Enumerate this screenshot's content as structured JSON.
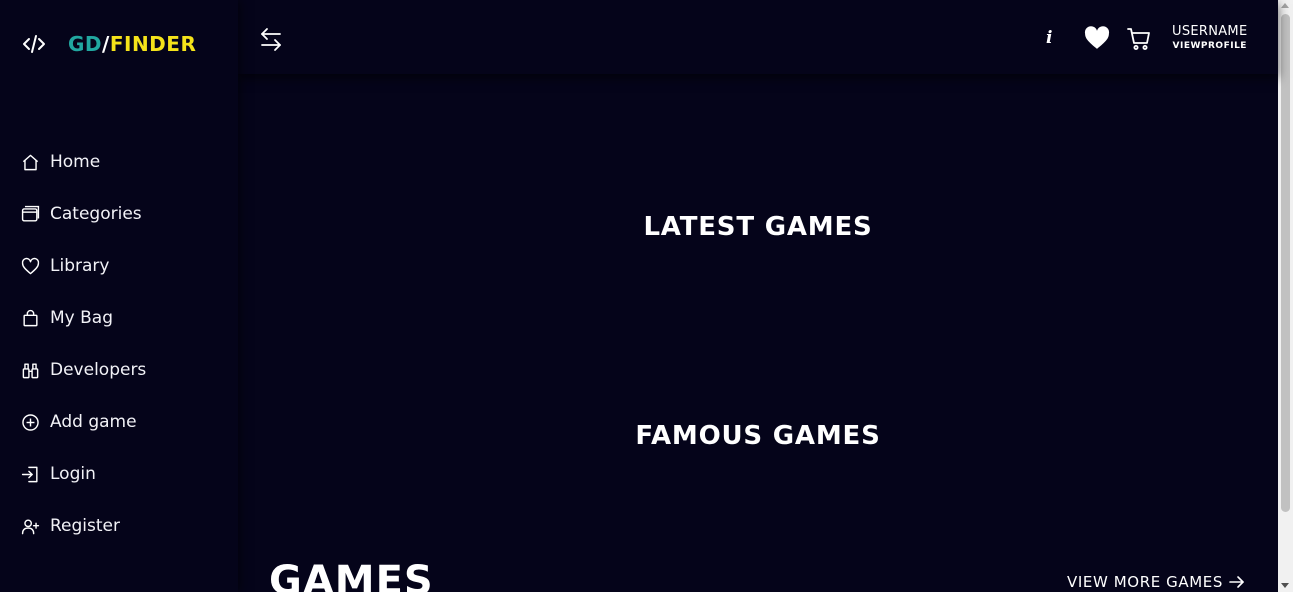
{
  "brand": {
    "gd": "GD",
    "slash": "/",
    "finder": "FINDER",
    "icon": "code-icon"
  },
  "colors": {
    "background": "#05041a",
    "brand_gd": "#21a7a0",
    "brand_finder": "#f5e31a",
    "text": "#ffffff"
  },
  "sidebar": {
    "items": [
      {
        "label": "Home",
        "icon": "home-icon"
      },
      {
        "label": "Categories",
        "icon": "categories-icon"
      },
      {
        "label": "Library",
        "icon": "heart-outline-icon"
      },
      {
        "label": "My Bag",
        "icon": "bag-icon"
      },
      {
        "label": "Developers",
        "icon": "binoculars-icon"
      },
      {
        "label": "Add game",
        "icon": "plus-circle-icon"
      },
      {
        "label": "Login",
        "icon": "login-icon"
      },
      {
        "label": "Register",
        "icon": "user-plus-icon"
      }
    ]
  },
  "topbar": {
    "toggle_icon": "arrows-left-right-icon",
    "info_icon_text": "i",
    "username": "USERNAME",
    "viewprofile": "VIEWPROFILE"
  },
  "main": {
    "latest_title": "LATEST GAMES",
    "famous_title": "FAMOUS GAMES",
    "games_title": "GAMES",
    "view_more": "VIEW MORE GAMES"
  }
}
